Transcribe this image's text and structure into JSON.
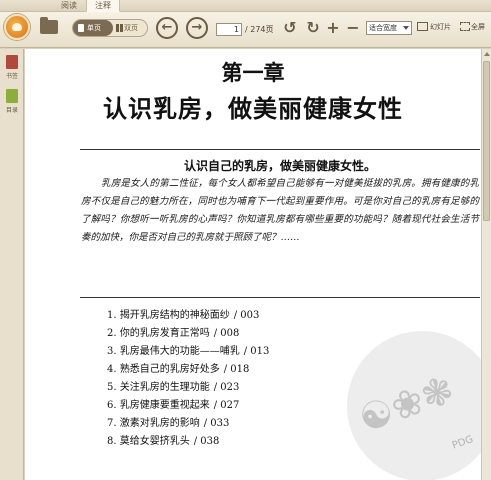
{
  "tabs": [
    {
      "label": "阅读"
    },
    {
      "label": "注释"
    }
  ],
  "toolbar": {
    "single_page_label": "单页",
    "double_page_label": "双页",
    "current_page": "1",
    "page_total": "/ 274页",
    "fit_option": "适合宽度",
    "slideshow_label": "幻灯片",
    "fullscreen_label": "全屏"
  },
  "sidebar": {
    "items": [
      {
        "label": "书签",
        "icon": "bookmark-icon"
      },
      {
        "label": "目录",
        "icon": "toc-icon"
      }
    ]
  },
  "document": {
    "chapter_number": "第一章",
    "chapter_title": "认识乳房，做美丽健康女性",
    "intro_heading": "认识自己的乳房，做美丽健康女性。",
    "intro_paragraph": "乳房是女人的第二性征，每个女人都希望自己能够有一对健美挺拔的乳房。拥有健康的乳房不仅是自己的魅力所在，同时也为哺育下一代起到重要作用。可是你对自己的乳房有足够的了解吗？你想听一听乳房的心声吗？你知道乳房都有哪些重要的功能吗？随着现代社会生活节奏的加快，你是否对自己的乳房就于照顾了呢？……",
    "toc": [
      {
        "title": "1. 揭开乳房结构的神秘面纱",
        "page": "/ 003"
      },
      {
        "title": "2. 你的乳房发育正常吗",
        "page": "/ 008"
      },
      {
        "title": "3. 乳房最伟大的功能——哺乳",
        "page": "/ 013"
      },
      {
        "title": "4. 熟悉自己的乳房好处多",
        "page": "/ 018"
      },
      {
        "title": "5. 关注乳房的生理功能",
        "page": "/ 023"
      },
      {
        "title": "6. 乳房健康要重视起来",
        "page": "/ 027"
      },
      {
        "title": "7. 激素对乳房的影响",
        "page": "/ 033"
      },
      {
        "title": "8. 莫给女婴挤乳头",
        "page": "/ 038"
      }
    ],
    "watermark_label": "PDG"
  },
  "colors": {
    "toolbar_bg": "#efe7d4",
    "accent_brown": "#7c6a52",
    "page_bg": "#ffffff"
  }
}
